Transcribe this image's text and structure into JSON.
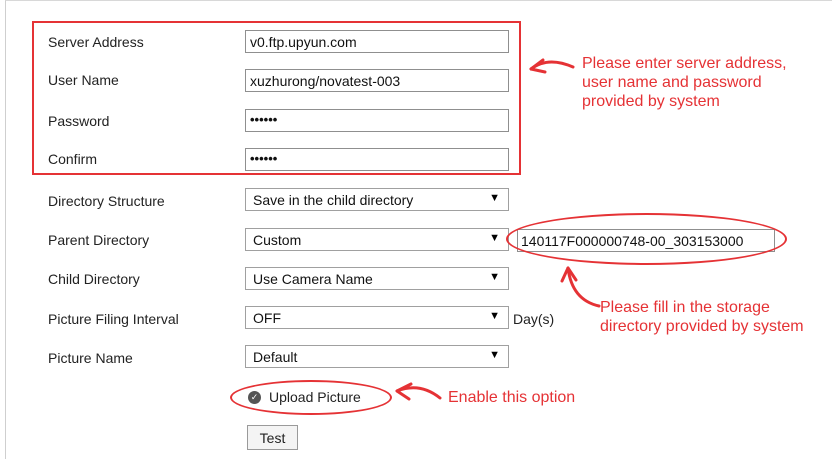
{
  "form": {
    "server_address": {
      "label": "Server Address",
      "value": "v0.ftp.upyun.com"
    },
    "user_name": {
      "label": "User Name",
      "value": "xuzhurong/novatest-003"
    },
    "password": {
      "label": "Password",
      "value": "••••••"
    },
    "confirm": {
      "label": "Confirm",
      "value": "••••••"
    },
    "directory_structure": {
      "label": "Directory Structure",
      "value": "Save in the child directory"
    },
    "parent_directory": {
      "label": "Parent Directory",
      "value": "Custom",
      "custom_value": "140117F000000748-00_303153000"
    },
    "child_directory": {
      "label": "Child Directory",
      "value": "Use Camera Name"
    },
    "picture_filing_interval": {
      "label": "Picture Filing Interval",
      "value": "OFF",
      "suffix": "Day(s)"
    },
    "picture_name": {
      "label": "Picture Name",
      "value": "Default"
    },
    "upload_picture": {
      "label": "Upload Picture",
      "checked": true
    },
    "test_button": "Test",
    "select_arrow": "▼"
  },
  "annotations": {
    "server_note": [
      "Please enter server address,",
      "user name and password",
      "provided by system"
    ],
    "directory_note": [
      "Please fill in the storage",
      "directory provided by system"
    ],
    "upload_note": "Enable this option",
    "color": "#e53235"
  }
}
